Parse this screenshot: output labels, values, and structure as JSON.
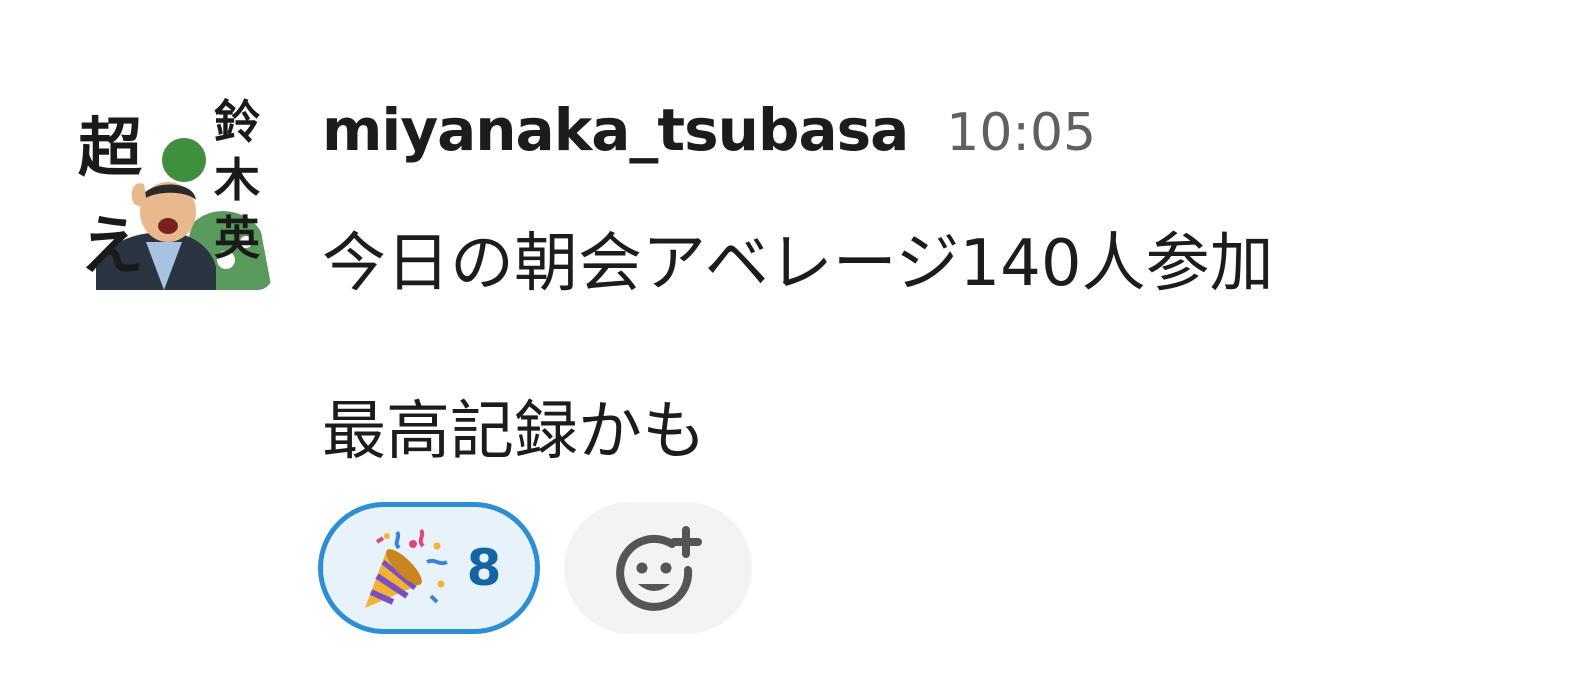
{
  "message": {
    "username": "miyanaka_tsubasa",
    "timestamp": "10:05",
    "lines": [
      "今日の朝会アベレージ140人参加",
      "最高記録かも"
    ]
  },
  "avatar": {
    "text_left_1": "超",
    "text_left_2": "え",
    "text_right_1": "鈴",
    "text_right_2": "木",
    "text_right_3": "英"
  },
  "reactions": [
    {
      "emoji": "party-popper-icon",
      "count": "8",
      "active": true
    }
  ],
  "add_reaction": {
    "icon": "add-emoji-icon"
  },
  "colors": {
    "username": "#1d1c1d",
    "timestamp": "#616061",
    "reaction_border": "#2d8ed3",
    "reaction_bg": "#e8f2fb",
    "reaction_count": "#1264a3",
    "add_reaction_bg": "#f3f3f3",
    "avatar_green": "#3f8f3f"
  }
}
